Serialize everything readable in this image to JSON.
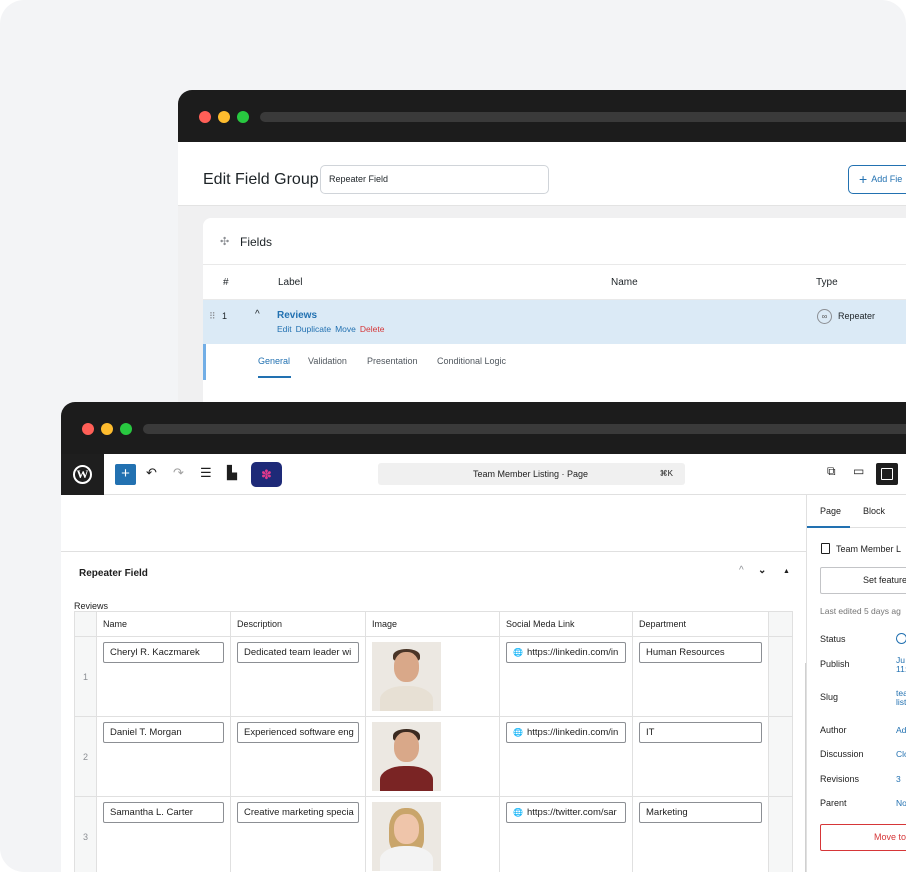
{
  "back_window": {
    "header": {
      "title": "Edit Field Group",
      "group_name": "Repeater Field",
      "add_field_label": "Add Fie"
    },
    "fields": {
      "title": "Fields",
      "columns": [
        "#",
        "Label",
        "Name",
        "Type"
      ],
      "row": {
        "number": "1",
        "label": "Reviews",
        "actions": {
          "edit": "Edit",
          "duplicate": "Duplicate",
          "move": "Move",
          "delete": "Delete"
        },
        "type": "Repeater"
      },
      "tabs": [
        "General",
        "Validation",
        "Presentation",
        "Conditional Logic"
      ]
    }
  },
  "front_window": {
    "toolbar": {
      "document_title": "Team Member Listing · Page",
      "shortcut": "⌘K"
    },
    "block": {
      "title": "Repeater Field",
      "field_label": "Reviews",
      "columns": [
        "Name",
        "Description",
        "Image",
        "Social Meda Link",
        "Department"
      ],
      "rows": [
        {
          "index": "1",
          "name": "Cheryl R. Kaczmarek",
          "description": "Dedicated team leader wi",
          "link": "https://linkedin.com/in",
          "department": "Human Resources"
        },
        {
          "index": "2",
          "name": "Daniel T. Morgan",
          "description": "Experienced software eng",
          "link": "https://linkedin.com/in",
          "department": "IT"
        },
        {
          "index": "3",
          "name": "Samantha L. Carter",
          "description": "Creative marketing specia",
          "link": "https://twitter.com/sar",
          "department": "Marketing"
        }
      ]
    },
    "sidebar": {
      "tabs": [
        "Page",
        "Block"
      ],
      "document": "Team Member L",
      "featured_image": "Set feature",
      "last_edited": "Last edited 5 days ag",
      "status_label": "Status",
      "publish_label": "Publish",
      "publish_value_1": "Ju",
      "publish_value_2": "11:",
      "slug_label": "Slug",
      "slug_value_1": "tea",
      "slug_value_2": "list",
      "author_label": "Author",
      "author_value": "Ad",
      "discussion_label": "Discussion",
      "discussion_value": "Clo",
      "revisions_label": "Revisions",
      "revisions_value": "3",
      "parent_label": "Parent",
      "parent_value": "No",
      "move_to_trash": "Move to"
    }
  }
}
